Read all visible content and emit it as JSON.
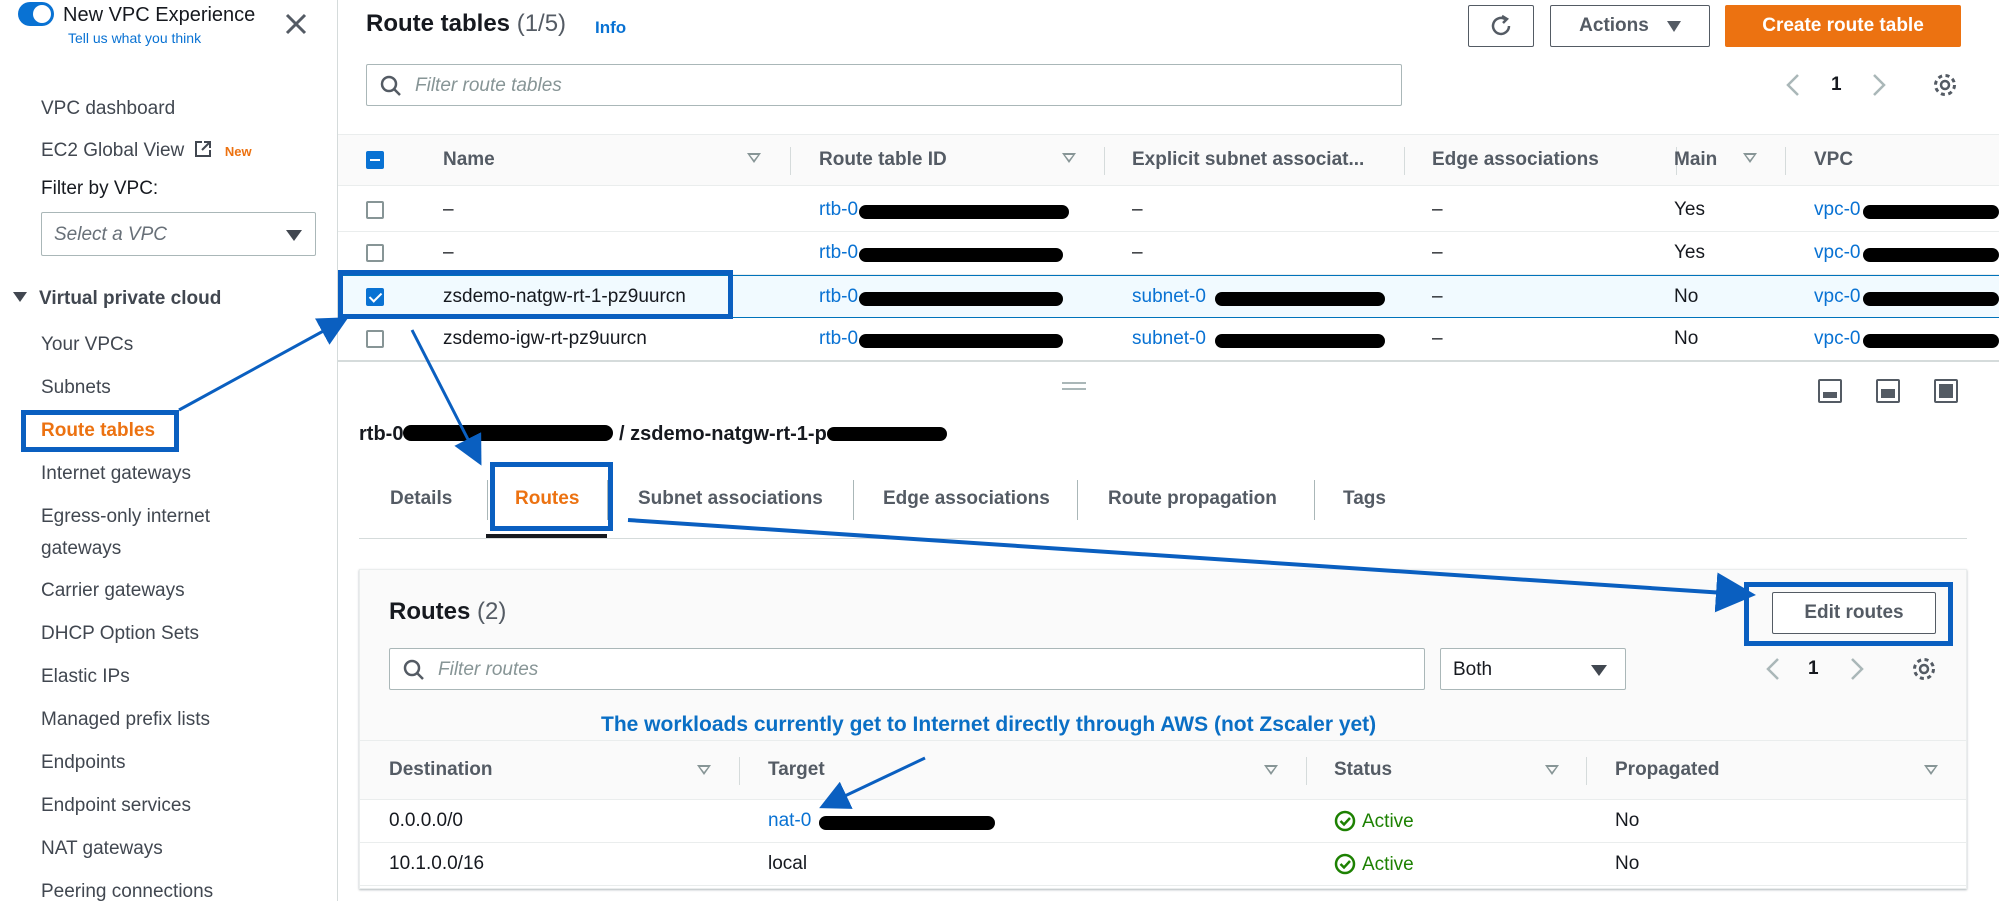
{
  "sidebar": {
    "experience_title": "New VPC Experience",
    "experience_link": "Tell us what you think",
    "items_top": [
      "VPC dashboard",
      "EC2 Global View"
    ],
    "new_badge": "New",
    "filter_label": "Filter by VPC:",
    "vpc_select_placeholder": "Select a VPC",
    "section": "Virtual private cloud",
    "items": [
      "Your VPCs",
      "Subnets",
      "Route tables",
      "Internet gateways",
      "Egress-only internet gateways",
      "Carrier gateways",
      "DHCP Option Sets",
      "Elastic IPs",
      "Managed prefix lists",
      "Endpoints",
      "Endpoint services",
      "NAT gateways",
      "Peering connections"
    ],
    "active_item": "Route tables"
  },
  "header": {
    "title": "Route tables",
    "count": "(1/5)",
    "info": "Info",
    "actions_label": "Actions",
    "create_label": "Create route table",
    "search_placeholder": "Filter route tables",
    "page": "1"
  },
  "route_tables": {
    "columns": [
      "Name",
      "Route table ID",
      "Explicit subnet associat...",
      "Edge associations",
      "Main",
      "VPC"
    ],
    "rows": [
      {
        "name": "–",
        "id": "rtb-0",
        "subnet": "–",
        "edge": "–",
        "main": "Yes",
        "vpc": "vpc-0",
        "selected": false
      },
      {
        "name": "–",
        "id": "rtb-0",
        "subnet": "–",
        "edge": "–",
        "main": "Yes",
        "vpc": "vpc-0",
        "selected": false
      },
      {
        "name": "zsdemo-natgw-rt-1-pz9uurcn",
        "id": "rtb-0",
        "subnet": "subnet-0",
        "edge": "–",
        "main": "No",
        "vpc": "vpc-0",
        "selected": true
      },
      {
        "name": "zsdemo-igw-rt-pz9uurcn",
        "id": "rtb-0",
        "subnet": "subnet-0",
        "edge": "–",
        "main": "No",
        "vpc": "vpc-0",
        "selected": false
      }
    ]
  },
  "detail": {
    "title_prefix": "rtb-0",
    "title_suffix": " / zsdemo-natgw-rt-1-p",
    "tabs": [
      "Details",
      "Routes",
      "Subnet associations",
      "Edge associations",
      "Route propagation",
      "Tags"
    ],
    "active_tab": "Routes"
  },
  "routes": {
    "title": "Routes",
    "count": "(2)",
    "edit_label": "Edit routes",
    "search_placeholder": "Filter routes",
    "filter_value": "Both",
    "page": "1",
    "columns": [
      "Destination",
      "Target",
      "Status",
      "Propagated"
    ],
    "rows": [
      {
        "destination": "0.0.0.0/0",
        "target": "nat-0",
        "status": "Active",
        "propagated": "No"
      },
      {
        "destination": "10.1.0.0/16",
        "target": "local",
        "status": "Active",
        "propagated": "No"
      }
    ]
  },
  "annotation": "The workloads currently get to Internet directly through AWS (not Zscaler yet)",
  "colors": {
    "accent": "#ec7211",
    "link": "#0972d3",
    "callout": "#0a5fc0",
    "active": "#1d8102"
  }
}
